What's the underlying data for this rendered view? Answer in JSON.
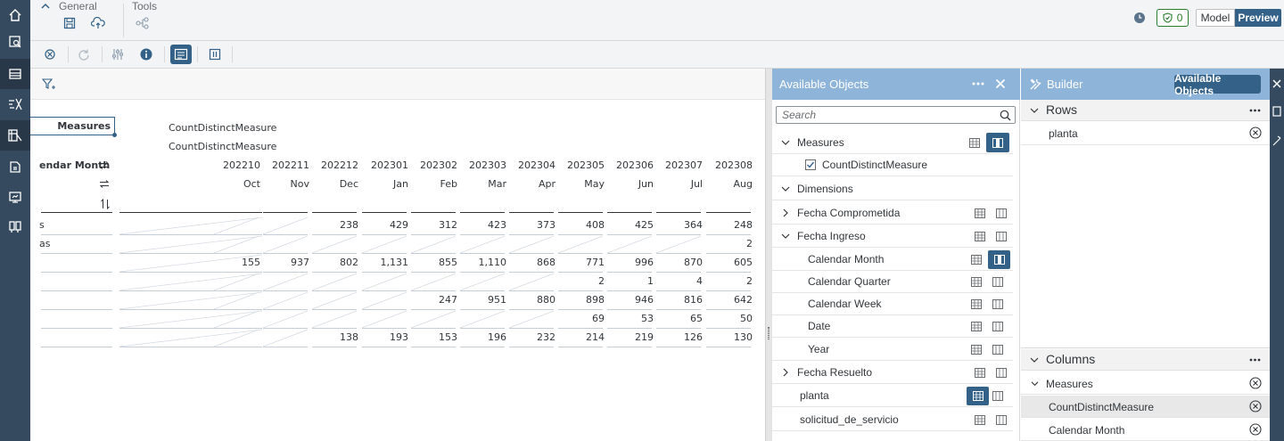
{
  "toolbar": {
    "general_label": "General",
    "tools_label": "Tools",
    "badge_count": "0",
    "model_label": "Model",
    "preview_label": "Preview"
  },
  "table": {
    "measures_label": "Measures",
    "measure_name_1": "CountDistinctMeasure",
    "measure_name_2": "CountDistinctMeasure",
    "calendar_month_label": "endar Month",
    "columns": [
      {
        "code": "202210",
        "month": "Oct"
      },
      {
        "code": "202211",
        "month": "Nov"
      },
      {
        "code": "202212",
        "month": "Dec"
      },
      {
        "code": "202301",
        "month": "Jan"
      },
      {
        "code": "202302",
        "month": "Feb"
      },
      {
        "code": "202303",
        "month": "Mar"
      },
      {
        "code": "202304",
        "month": "Apr"
      },
      {
        "code": "202305",
        "month": "May"
      },
      {
        "code": "202306",
        "month": "Jun"
      },
      {
        "code": "202307",
        "month": "Jul"
      },
      {
        "code": "202308",
        "month": "Aug"
      }
    ],
    "row_labels": [
      "s",
      "as",
      "",
      "",
      "",
      "",
      ""
    ],
    "rows": [
      [
        "",
        "",
        "238",
        "429",
        "312",
        "423",
        "373",
        "408",
        "425",
        "364",
        "248"
      ],
      [
        "",
        "",
        "",
        "",
        "",
        "",
        "",
        "",
        "",
        "",
        "2"
      ],
      [
        "155",
        "937",
        "802",
        "1,131",
        "855",
        "1,110",
        "868",
        "771",
        "996",
        "870",
        "605"
      ],
      [
        "",
        "",
        "",
        "",
        "",
        "",
        "",
        "2",
        "1",
        "4",
        "2"
      ],
      [
        "",
        "",
        "",
        "",
        "247",
        "951",
        "880",
        "898",
        "946",
        "816",
        "642"
      ],
      [
        "",
        "",
        "",
        "",
        "",
        "",
        "",
        "69",
        "53",
        "65",
        "50"
      ],
      [
        "",
        "",
        "138",
        "193",
        "153",
        "196",
        "232",
        "214",
        "219",
        "126",
        "130"
      ]
    ]
  },
  "available_objects": {
    "title": "Available Objects",
    "search_placeholder": "Search",
    "measures_header": "Measures",
    "measure_item": "CountDistinctMeasure",
    "dimensions_header": "Dimensions",
    "fecha_comprometida": "Fecha Comprometida",
    "fecha_ingreso": "Fecha Ingreso",
    "calendar_month": "Calendar Month",
    "calendar_quarter": "Calendar Quarter",
    "calendar_week": "Calendar Week",
    "date": "Date",
    "year": "Year",
    "fecha_resuelto": "Fecha Resuelto",
    "planta": "planta",
    "solicitud": "solicitud_de_servicio"
  },
  "builder": {
    "title": "Builder",
    "available_objects_button": "Available Objects",
    "rows_header": "Rows",
    "rows_item": "planta",
    "columns_header": "Columns",
    "col_measures": "Measures",
    "col_measure_item": "CountDistinctMeasure",
    "col_calendar_month": "Calendar Month"
  },
  "colors": {
    "nav": "#354a5f",
    "panel_header": "#8eb4d9",
    "accent": "#346187"
  }
}
